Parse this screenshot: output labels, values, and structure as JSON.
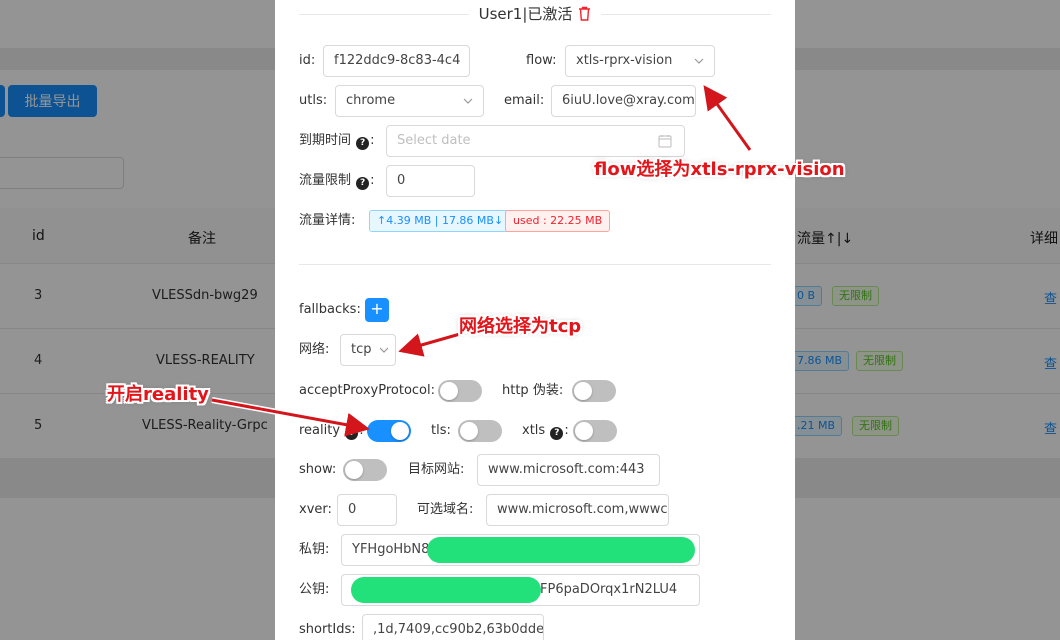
{
  "background": {
    "export_button": "批量导出",
    "columns": [
      "id",
      "备注",
      "流量↑|↓",
      "详细"
    ],
    "rows": [
      {
        "id": "3",
        "remark": "VLESSdn-bwg29",
        "traffic": "0 B",
        "limit": "无限制",
        "link": "查"
      },
      {
        "id": "4",
        "remark": "VLESS-REALITY",
        "traffic": "7.86 MB",
        "limit": "无限制",
        "link": "查"
      },
      {
        "id": "5",
        "remark": "VLESS-Reality-Grpc",
        "traffic": ".21 MB",
        "limit": "无限制",
        "link": "查"
      }
    ]
  },
  "modal": {
    "user_title": "User1|已激活",
    "id_label": "id",
    "id_value": "f122ddc9-8c83-4c4",
    "flow_label": "flow",
    "flow_value": "xtls-rprx-vision",
    "utls_label": "utls",
    "utls_value": "chrome",
    "email_label": "email",
    "email_value": "6iuU.love@xray.com",
    "expiry_label": "到期时间",
    "expiry_placeholder": "Select date",
    "traffic_limit_label": "流量限制",
    "traffic_limit_value": "0",
    "traffic_detail_label": "流量详情",
    "traffic_up_down": "↑4.39 MB | 17.86 MB↓",
    "traffic_used": "used : 22.25 MB",
    "fallbacks_label": "fallbacks",
    "fallbacks_add": "+",
    "network_label": "网络",
    "network_value": "tcp",
    "accept_proxy_label": "acceptProxyProtocol",
    "accept_proxy_on": false,
    "http_camouflage_label": "http 伪装",
    "http_camouflage_on": false,
    "reality_label": "reality",
    "reality_on": true,
    "tls_label": "tls",
    "tls_on": false,
    "xtls_label": "xtls",
    "xtls_on": false,
    "show_label": "show",
    "show_on": false,
    "target_site_label": "目标网站",
    "target_site_value": "www.microsoft.com:443",
    "xver_label": "xver",
    "xver_value": "0",
    "server_names_label": "可选域名",
    "server_names_value": "www.microsoft.com,wwwc",
    "private_key_label": "私钥",
    "private_key_value": "YFHgoHbN8",
    "public_key_label": "公钥",
    "public_key_value": "FP6paDOrqx1rN2LU4",
    "short_ids_label": "shortIds",
    "short_ids_value": ",1d,7409,cc90b2,63b0dde"
  },
  "annotations": {
    "flow_note": "flow选择为xtls-rprx-vision",
    "network_note": "网络选择为tcp",
    "reality_note": "开启reality"
  },
  "colors": {
    "primary": "#1890ff",
    "annotation_red": "#e2151b",
    "redaction_green": "#22e07a"
  }
}
